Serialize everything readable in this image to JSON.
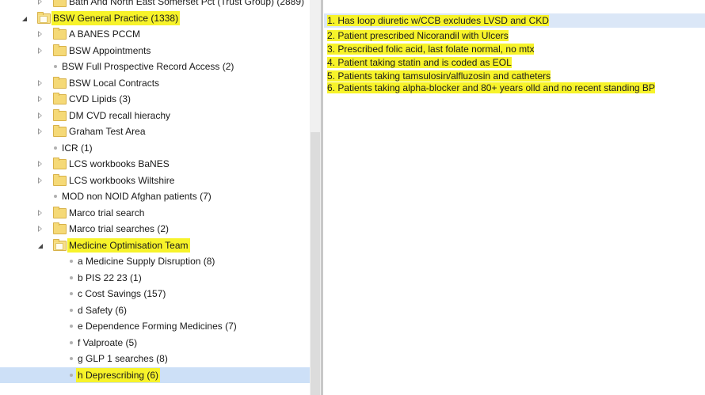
{
  "tree": {
    "items": [
      {
        "label": "Bath And North East Somerset Pct (Trust Group) (2889)",
        "type": "folder",
        "level": 1,
        "expander": "collapsed"
      },
      {
        "label": "BSW General Practice (1338)",
        "type": "folder-open",
        "level": 0,
        "expander": "expanded",
        "highlighted": true
      },
      {
        "label": "A BANES PCCM",
        "type": "folder",
        "level": 1,
        "expander": "collapsed"
      },
      {
        "label": "BSW Appointments",
        "type": "folder",
        "level": 1,
        "expander": "collapsed"
      },
      {
        "label": "BSW Full Prospective Record Access (2)",
        "type": "search",
        "level": 1,
        "expander": "none"
      },
      {
        "label": "BSW Local Contracts",
        "type": "folder",
        "level": 1,
        "expander": "collapsed"
      },
      {
        "label": "CVD Lipids (3)",
        "type": "folder",
        "level": 1,
        "expander": "collapsed"
      },
      {
        "label": "DM CVD recall hierachy",
        "type": "folder",
        "level": 1,
        "expander": "collapsed"
      },
      {
        "label": "Graham Test Area",
        "type": "folder",
        "level": 1,
        "expander": "collapsed"
      },
      {
        "label": "ICR (1)",
        "type": "search",
        "level": 1,
        "expander": "none"
      },
      {
        "label": "LCS workbooks BaNES",
        "type": "folder",
        "level": 1,
        "expander": "collapsed"
      },
      {
        "label": "LCS workbooks Wiltshire",
        "type": "folder",
        "level": 1,
        "expander": "collapsed"
      },
      {
        "label": "MOD non NOID Afghan patients (7)",
        "type": "search",
        "level": 1,
        "expander": "none"
      },
      {
        "label": "Marco trial search",
        "type": "folder",
        "level": 1,
        "expander": "collapsed"
      },
      {
        "label": "Marco trial searches (2)",
        "type": "folder",
        "level": 1,
        "expander": "collapsed"
      },
      {
        "label": "Medicine Optimisation Team",
        "type": "folder-open",
        "level": 1,
        "expander": "expanded",
        "highlighted": true
      },
      {
        "label": "a Medicine Supply Disruption (8)",
        "type": "search",
        "level": 2,
        "expander": "none"
      },
      {
        "label": "b PIS 22 23 (1)",
        "type": "search",
        "level": 2,
        "expander": "none"
      },
      {
        "label": "c Cost Savings (157)",
        "type": "search",
        "level": 2,
        "expander": "none"
      },
      {
        "label": "d Safety (6)",
        "type": "search",
        "level": 2,
        "expander": "none"
      },
      {
        "label": "e Dependence Forming Medicines (7)",
        "type": "search",
        "level": 2,
        "expander": "none"
      },
      {
        "label": "f  Valproate (5)",
        "type": "search",
        "level": 2,
        "expander": "none"
      },
      {
        "label": "g GLP 1 searches (8)",
        "type": "search",
        "level": 2,
        "expander": "none"
      },
      {
        "label": "h Deprescribing (6)",
        "type": "search",
        "level": 2,
        "expander": "none",
        "highlighted": true,
        "selected": true
      }
    ]
  },
  "search_list": {
    "items": [
      {
        "label": "1. Has loop diuretic w/CCB excludes LVSD and CKD",
        "selected": true
      },
      {
        "label": "2. Patient prescribed Nicorandil with Ulcers"
      },
      {
        "label": "3. Prescribed folic acid, last folate normal, no mtx"
      },
      {
        "label": "4. Patient taking statin and is coded as EOL"
      },
      {
        "label": "5. Patients taking tamsulosin/alfluzosin and catheters"
      },
      {
        "label": "6. Patients taking alpha-blocker and 80+ years olld and no recent standing BP"
      }
    ]
  },
  "colors": {
    "highlight": "#f7f32a",
    "selection": "#cde0f7",
    "folder": "#f5d977"
  }
}
